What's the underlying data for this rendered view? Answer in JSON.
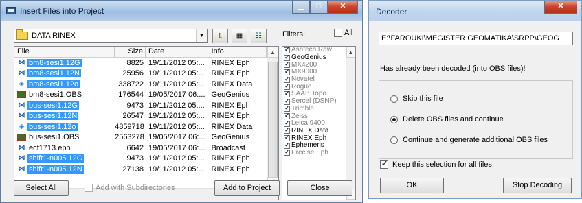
{
  "insert_window": {
    "title": "Insert Files into Project",
    "folder_path": "DATA RINEX",
    "filters_label": "Filters:",
    "all_label": "All",
    "columns": [
      "File",
      "Size",
      "Date",
      "Info"
    ],
    "files": [
      {
        "name": "bm8-sesi1.12G",
        "size": "8825",
        "date": "19/11/2012 05:...",
        "info": "RINEX Eph",
        "icon": "eph-icon",
        "selected": true
      },
      {
        "name": "bm8-sesi1.12N",
        "size": "25956",
        "date": "19/11/2012 05:...",
        "info": "RINEX Eph",
        "icon": "eph-icon",
        "selected": true
      },
      {
        "name": "bm8-sesi1.12o",
        "size": "338722",
        "date": "19/11/2012 05:...",
        "info": "RINEX Data",
        "icon": "data-icon",
        "selected": true
      },
      {
        "name": "bm8-sesi1.OBS",
        "size": "176544",
        "date": "19/05/2017 06:...",
        "info": "GeoGenius",
        "icon": "obs-icon",
        "selected": false
      },
      {
        "name": "bus-sesi1.12G",
        "size": "9473",
        "date": "19/11/2012 05:...",
        "info": "RINEX Eph",
        "icon": "eph-icon",
        "selected": true
      },
      {
        "name": "bus-sesi1.12N",
        "size": "26547",
        "date": "19/11/2012 05:...",
        "info": "RINEX Eph",
        "icon": "eph-icon",
        "selected": true
      },
      {
        "name": "bus-sesi1.12o",
        "size": "4859718",
        "date": "19/11/2012 05:...",
        "info": "RINEX Data",
        "icon": "data-icon",
        "selected": true
      },
      {
        "name": "bus-sesi1.OBS",
        "size": "2563278",
        "date": "19/05/2017 06:...",
        "info": "GeoGenius",
        "icon": "obs-icon",
        "selected": false
      },
      {
        "name": "ecf1713.eph",
        "size": "6642",
        "date": "19/05/2017 06:...",
        "info": "Broadcast",
        "icon": "eph-icon",
        "selected": false
      },
      {
        "name": "shift1-n005.12G",
        "size": "9473",
        "date": "19/11/2012 05:...",
        "info": "RINEX Eph",
        "icon": "eph-icon",
        "selected": true
      },
      {
        "name": "shift1-n005.12N",
        "size": "27138",
        "date": "19/11/2012 05:...",
        "info": "RINEX Eph",
        "icon": "eph-icon",
        "selected": true
      }
    ],
    "filters": [
      {
        "label": "Ashtech Raw",
        "checked": true,
        "dim": true
      },
      {
        "label": "GeoGenius",
        "checked": true,
        "dim": false
      },
      {
        "label": "MX4200",
        "checked": true,
        "dim": true
      },
      {
        "label": "MX9000",
        "checked": true,
        "dim": true
      },
      {
        "label": "Novatel",
        "checked": true,
        "dim": true
      },
      {
        "label": "Rogue",
        "checked": true,
        "dim": true
      },
      {
        "label": "SAAB Topo",
        "checked": true,
        "dim": true
      },
      {
        "label": "Sercel (DSNP)",
        "checked": true,
        "dim": true
      },
      {
        "label": "Trimble",
        "checked": true,
        "dim": true
      },
      {
        "label": "Zeiss",
        "checked": true,
        "dim": true
      },
      {
        "label": "Leica 9400",
        "checked": true,
        "dim": true
      },
      {
        "label": "RINEX Data",
        "checked": true,
        "dim": false
      },
      {
        "label": "RINEX Eph",
        "checked": true,
        "dim": false
      },
      {
        "label": "Ephemeris",
        "checked": true,
        "dim": false
      },
      {
        "label": "Precise Eph.",
        "checked": true,
        "dim": true
      }
    ],
    "select_all_label": "Select All",
    "subdirs_label": "Add with Subdirectories",
    "add_label": "Add to Project",
    "close_label": "Close"
  },
  "decoder_window": {
    "title": "Decoder",
    "path": "E:\\FAROUKI\\MEGISTER GEOMATIKA\\SRPP\\GEOG",
    "message": "Has already been decoded (into OBS files)!",
    "options": [
      {
        "label": "Skip this file",
        "selected": false
      },
      {
        "label": "Delete OBS files and continue",
        "selected": true
      },
      {
        "label": "Continue and generate additional OBS files",
        "selected": false
      }
    ],
    "keep_label": "Keep this selection for all files",
    "ok_label": "OK",
    "stop_label": "Stop Decoding"
  }
}
